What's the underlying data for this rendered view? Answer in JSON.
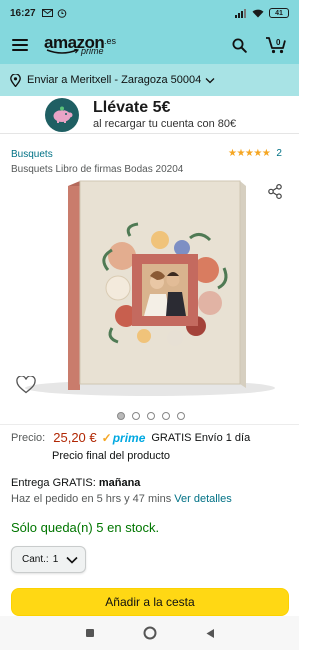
{
  "status_bar": {
    "time": "16:27",
    "battery": "41"
  },
  "header": {
    "logo_text": "amazon",
    "logo_tld": ".es",
    "logo_prime": "prime"
  },
  "location": {
    "text": "Enviar a Meritxell - Zaragoza 50004"
  },
  "promo": {
    "title": "Llévate 5€",
    "subtitle": "al recargar tu cuenta con 80€"
  },
  "product": {
    "brand": "Busquets",
    "rating_stars": "★★★★★",
    "rating_count": "2",
    "title": "Busquets Libro de firmas Bodas 20204",
    "image_count": 5,
    "active_image": 0
  },
  "pricing": {
    "label": "Precio:",
    "price": "25,20 €",
    "prime_label": "prime",
    "free_shipping": "GRATIS Envío 1 día",
    "final_price_note": "Precio final del producto"
  },
  "delivery": {
    "prefix": "Entrega GRATIS:",
    "day": "mañana",
    "order_by": "Haz el pedido en 5 hrs y 47 mins",
    "details_link": "Ver detalles"
  },
  "stock": {
    "text": "Sólo queda(n) 5 en stock."
  },
  "quantity": {
    "label": "Cant.:",
    "value": "1"
  },
  "cart": {
    "add_label": "Añadir a la cesta"
  },
  "colors": {
    "header_bg": "#84d8dd",
    "location_bg": "#a8e3e5",
    "price": "#b12704",
    "link": "#007185",
    "stock": "#007600",
    "cart_button": "#ffd814"
  }
}
